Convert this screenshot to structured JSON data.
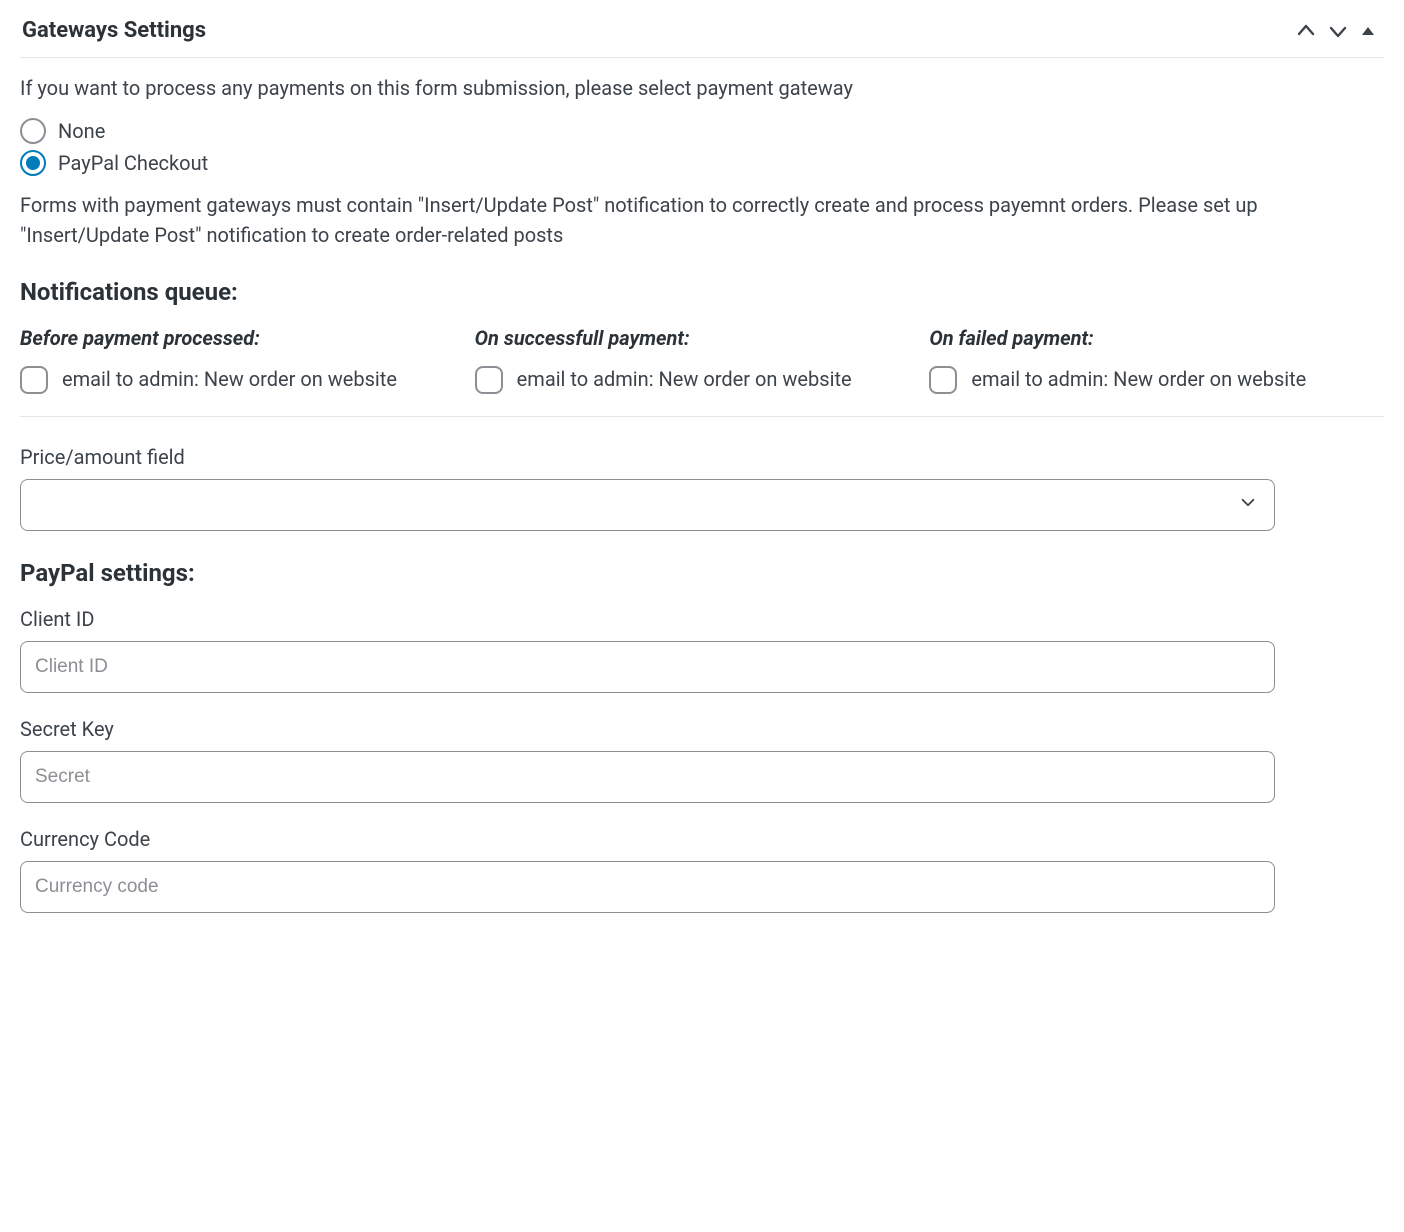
{
  "panel": {
    "title": "Gateways Settings"
  },
  "intro": "If you want to process any payments on this form submission, please select payment gateway",
  "gateways": [
    {
      "label": "None",
      "selected": false
    },
    {
      "label": "PayPal Checkout",
      "selected": true
    }
  ],
  "notice": "Forms with payment gateways must contain \"Insert/Update Post\" notification to correctly create and process payemnt orders. Please set up \"Insert/Update Post\" notification to create order-related posts",
  "queue": {
    "heading": "Notifications queue:",
    "cols": [
      {
        "title": "Before payment processed:",
        "items": [
          "email to admin: New order on website"
        ]
      },
      {
        "title": "On successfull payment:",
        "items": [
          "email to admin: New order on website"
        ]
      },
      {
        "title": "On failed payment:",
        "items": [
          "email to admin: New order on website"
        ]
      }
    ]
  },
  "price_field": {
    "label": "Price/amount field",
    "value": ""
  },
  "paypal": {
    "heading": "PayPal settings:",
    "client_id": {
      "label": "Client ID",
      "placeholder": "Client ID",
      "value": ""
    },
    "secret": {
      "label": "Secret Key",
      "placeholder": "Secret",
      "value": ""
    },
    "currency": {
      "label": "Currency Code",
      "placeholder": "Currency code",
      "value": ""
    }
  }
}
